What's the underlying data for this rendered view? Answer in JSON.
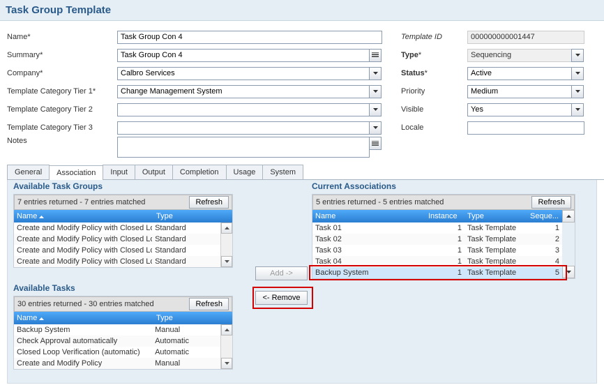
{
  "title": "Task Group Template",
  "labels": {
    "name": "Name",
    "summary": "Summary",
    "company": "Company",
    "tier1": "Template Category Tier 1",
    "tier2": "Template Category Tier 2",
    "tier3": "Template Category Tier 3",
    "notes": "Notes",
    "templateId": "Template ID",
    "type": "Type",
    "status": "Status",
    "priority": "Priority",
    "visible": "Visible",
    "locale": "Locale"
  },
  "values": {
    "name": "Task Group Con 4",
    "summary": "Task Group Con 4",
    "company": "Calbro Services",
    "tier1": "Change Management System",
    "tier2": "",
    "tier3": "",
    "notes": "",
    "templateId": "000000000001447",
    "type": "Sequencing",
    "status": "Active",
    "priority": "Medium",
    "visible": "Yes",
    "locale": ""
  },
  "tabs": [
    "General",
    "Association",
    "Input",
    "Output",
    "Completion",
    "Usage",
    "System"
  ],
  "activeTab": 1,
  "groups": {
    "title": "Available Task Groups",
    "status": "7 entries returned - 7 entries matched",
    "refresh": "Refresh",
    "cols": [
      "Name",
      "Type"
    ],
    "rows": [
      [
        "Create and Modify Policy with Closed Lo",
        "Standard"
      ],
      [
        "Create and Modify Policy with Closed Lo",
        "Standard"
      ],
      [
        "Create and Modify Policy with Closed Lo",
        "Standard"
      ],
      [
        "Create and Modify Policy with Closed Lo",
        "Standard"
      ]
    ]
  },
  "tasks": {
    "title": "Available Tasks",
    "status": "30 entries returned - 30 entries matched",
    "refresh": "Refresh",
    "cols": [
      "Name",
      "Type"
    ],
    "rows": [
      [
        "Backup System",
        "Manual"
      ],
      [
        "Check Approval automatically",
        "Automatic"
      ],
      [
        "Closed Loop Verification (automatic)",
        "Automatic"
      ],
      [
        "Create and Modify Policy",
        "Manual"
      ]
    ]
  },
  "assoc": {
    "title": "Current Associations",
    "status": "5 entries returned - 5 entries matched",
    "refresh": "Refresh",
    "cols": [
      "Name",
      "Instance",
      "Type",
      "Seque..."
    ],
    "rows": [
      [
        "Task 01",
        "1",
        "Task Template",
        "1"
      ],
      [
        "Task 02",
        "1",
        "Task Template",
        "2"
      ],
      [
        "Task 03",
        "1",
        "Task Template",
        "3"
      ],
      [
        "Task 04",
        "1",
        "Task Template",
        "4"
      ],
      [
        "Backup System",
        "1",
        "Task Template",
        "5"
      ]
    ],
    "selected": 4
  },
  "buttons": {
    "add": "Add ->",
    "remove": "<- Remove"
  }
}
